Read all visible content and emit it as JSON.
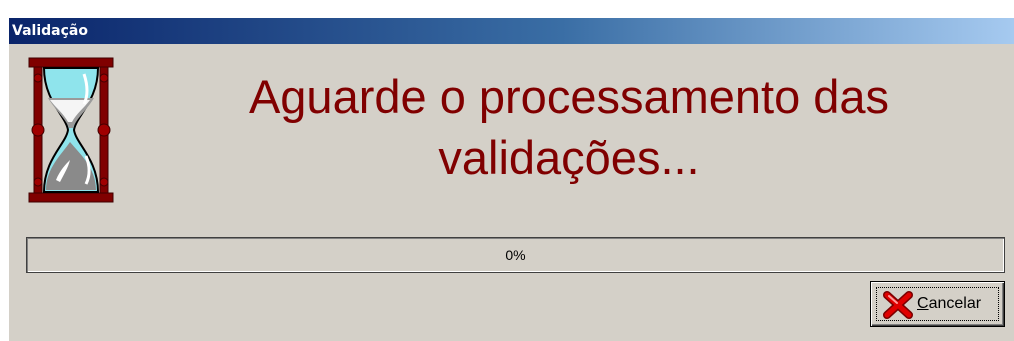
{
  "window": {
    "title": "Validação"
  },
  "message": {
    "line1": "Aguarde o processamento das",
    "line2": "validações..."
  },
  "progress": {
    "value": 0,
    "label": "0%"
  },
  "buttons": {
    "cancel": {
      "mnemonic": "C",
      "rest": "ancelar"
    }
  },
  "icons": {
    "hourglass": "hourglass-icon",
    "cancel": "red-x-icon"
  },
  "colors": {
    "message": "#800000",
    "dialog_bg": "#d4d0c8",
    "titlebar_start": "#0a246a",
    "titlebar_end": "#a6caf0"
  }
}
